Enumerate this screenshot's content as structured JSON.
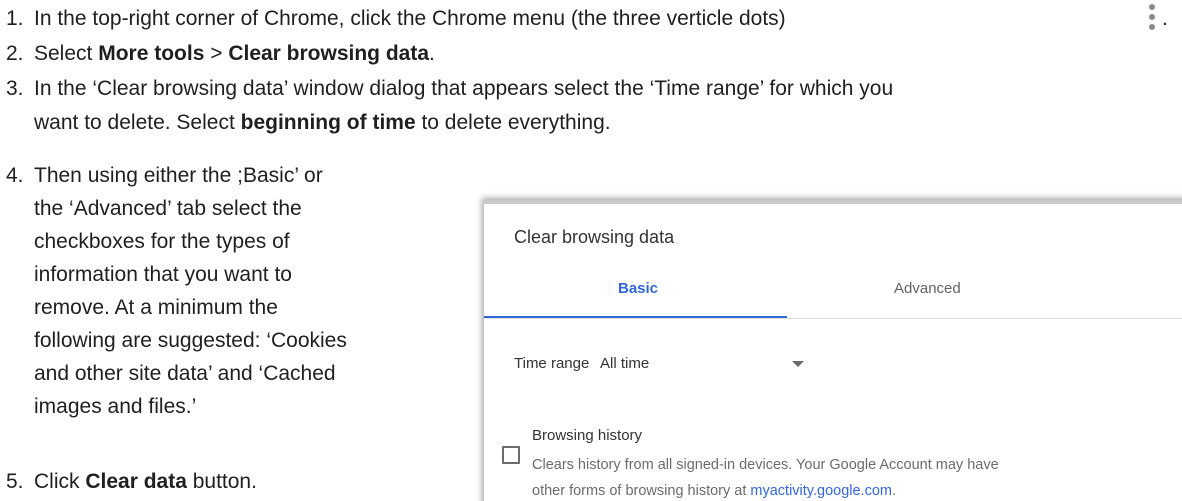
{
  "steps": [
    {
      "num": "1.",
      "text": "In the top-right corner of Chrome, click the Chrome menu  (the three verticle dots)",
      "trailing": "."
    },
    {
      "num": "2.",
      "prefix": "Select ",
      "bold1": "More tools",
      "sep": " > ",
      "bold2": "Clear browsing data",
      "suffix": "."
    },
    {
      "num": "3.",
      "line1": "In the ‘Clear browsing data’ window dialog that appears select the ‘Time range’ for which you",
      "line2_prefix": "want to delete. Select ",
      "line2_bold": "beginning of time",
      "line2_suffix": " to delete everything."
    },
    {
      "num": "4.",
      "lines": [
        "Then using either the ;Basic’ or",
        "the ‘Advanced’ tab select the",
        "checkboxes for the types of",
        "information that you want to",
        "remove.  At a minimum the",
        "following are suggested:  ‘Cookies",
        "and other site data’ and ‘Cached",
        "images and files.’"
      ]
    },
    {
      "num": "5.",
      "prefix": "Click ",
      "bold": "Clear data",
      "suffix": " button."
    }
  ],
  "dialog": {
    "title": "Clear browsing data",
    "tabs": {
      "basic": "Basic",
      "advanced": "Advanced",
      "active": "Basic"
    },
    "time_range": {
      "label": "Time range",
      "value": "All time"
    },
    "item": {
      "title": "Browsing history",
      "desc_line1": "Clears history from all signed-in devices. Your Google Account may have",
      "desc_line2_prefix": "other forms of browsing history at ",
      "link": "myactivity.google.com",
      "desc_line2_suffix": ".",
      "checked": false
    },
    "accent_color": "#3367d6"
  },
  "icons": {
    "chrome_menu": "three-vertical-dots-icon"
  }
}
